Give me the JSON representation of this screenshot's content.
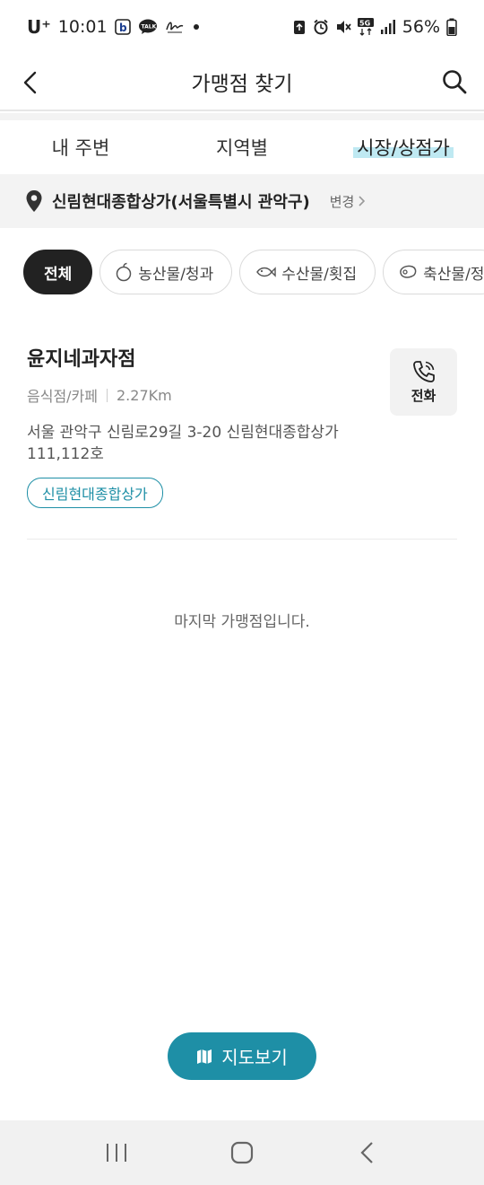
{
  "status_bar": {
    "carrier": "U⁺",
    "time": "10:01",
    "network": "5G",
    "battery": "56%"
  },
  "header": {
    "title": "가맹점 찾기"
  },
  "tabs": [
    {
      "label": "내 주변",
      "active": false
    },
    {
      "label": "지역별",
      "active": false
    },
    {
      "label": "시장/상점가",
      "active": true
    }
  ],
  "location": {
    "name": "신림현대종합상가(서울특별시 관악구)",
    "change_label": "변경"
  },
  "chips": [
    {
      "label": "전체",
      "active": true,
      "icon": "none"
    },
    {
      "label": "농산물/청과",
      "active": false,
      "icon": "fruit-icon"
    },
    {
      "label": "수산물/횟집",
      "active": false,
      "icon": "fish-icon"
    },
    {
      "label": "축산물/정",
      "active": false,
      "icon": "meat-icon"
    }
  ],
  "store": {
    "name": "윤지네과자점",
    "category": "음식점/카페",
    "distance": "2.27Km",
    "address": "서울 관악구 신림로29길 3-20 신림현대종합상가 111,112호",
    "market_tag": "신림현대종합상가",
    "call_label": "전화"
  },
  "end_message": "마지막 가맹점입니다.",
  "map_button": {
    "label": "지도보기"
  },
  "colors": {
    "accent": "#1e8fa6",
    "tab_highlight": "#bfe9f2",
    "chip_active": "#222222"
  }
}
